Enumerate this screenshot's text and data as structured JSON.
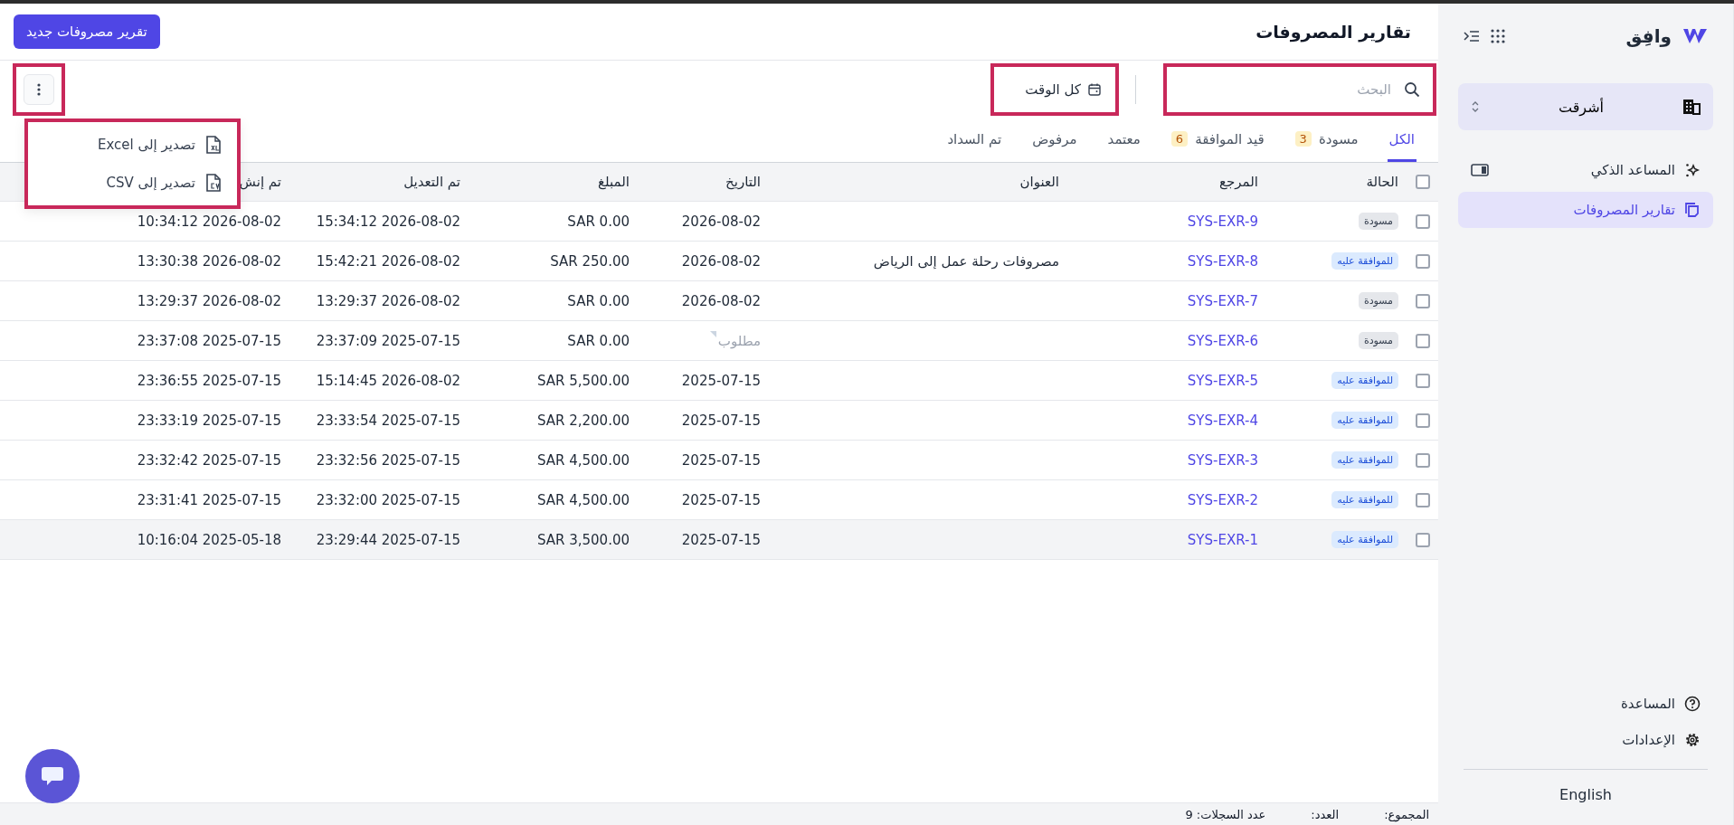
{
  "sidebar": {
    "logo_text": "وافِق",
    "org": "أشرقت",
    "nav": [
      {
        "label": "المساعد الذكي",
        "kind": "assistant",
        "selected": false
      },
      {
        "label": "تقارير المصروفات",
        "kind": "reports",
        "selected": true
      }
    ],
    "footer_links": [
      {
        "label": "المساعدة",
        "kind": "help"
      },
      {
        "label": "الإعدادات",
        "kind": "settings"
      }
    ],
    "language": "English"
  },
  "page": {
    "title": "تقارير المصروفات",
    "new_button": "تقرير مصروفات جديد"
  },
  "search": {
    "placeholder": "البحث",
    "highlighted": true
  },
  "date_filter": {
    "label": "كل الوقت",
    "highlighted": true
  },
  "more_button": {
    "highlighted": true
  },
  "more_menu": {
    "highlighted": true,
    "items": [
      {
        "label": "تصدير إلى Excel",
        "kind": "xls"
      },
      {
        "label": "تصدير إلى CSV",
        "kind": "csv"
      }
    ]
  },
  "tabs": [
    {
      "label": "الكل",
      "selected": true
    },
    {
      "label": "مسودة",
      "count": "3",
      "selected": false
    },
    {
      "label": "قيد الموافقة",
      "count": "6",
      "selected": false
    },
    {
      "label": "معتمد",
      "selected": false
    },
    {
      "label": "مرفوض",
      "selected": false
    },
    {
      "label": "تم السداد",
      "selected": false
    }
  ],
  "table": {
    "all_checked": false,
    "columns": [
      "الحالة",
      "المرجع",
      "العنوان",
      "التاريخ",
      "المبلغ",
      "تم التعديل",
      "تم إنش"
    ],
    "rows": [
      {
        "checked": false,
        "highlighted": false,
        "status": "مسودة",
        "kind": "draft",
        "reference": "SYS-EXR-9",
        "date": "2026-08-02",
        "amount": "SAR 0.00",
        "modified": "15:34:12 2026-08-02",
        "created": "10:34:12 2026-08-02"
      },
      {
        "checked": false,
        "highlighted": false,
        "status": "للموافقة عليه",
        "kind": "pending",
        "reference": "SYS-EXR-8",
        "title": "مصروفات رحلة عمل إلى الرياض",
        "date": "2026-08-02",
        "amount": "SAR 250.00",
        "modified": "15:42:21 2026-08-02",
        "created": "13:30:38 2026-08-02"
      },
      {
        "checked": false,
        "highlighted": false,
        "status": "مسودة",
        "kind": "draft",
        "reference": "SYS-EXR-7",
        "date": "2026-08-02",
        "amount": "SAR 0.00",
        "modified": "13:29:37 2026-08-02",
        "created": "13:29:37 2026-08-02"
      },
      {
        "checked": false,
        "highlighted": false,
        "status": "مسودة",
        "kind": "draft",
        "reference": "SYS-EXR-6",
        "date_placeholder": "مطلوب",
        "amount": "SAR 0.00",
        "modified": "23:37:09 2025-07-15",
        "created": "23:37:08 2025-07-15"
      },
      {
        "checked": false,
        "highlighted": false,
        "status": "للموافقة عليه",
        "kind": "pending",
        "reference": "SYS-EXR-5",
        "date": "2025-07-15",
        "amount": "SAR 5,500.00",
        "modified": "15:14:45 2026-08-02",
        "created": "23:36:55 2025-07-15"
      },
      {
        "checked": false,
        "highlighted": false,
        "status": "للموافقة عليه",
        "kind": "pending",
        "reference": "SYS-EXR-4",
        "date": "2025-07-15",
        "amount": "SAR 2,200.00",
        "modified": "23:33:54 2025-07-15",
        "created": "23:33:19 2025-07-15"
      },
      {
        "checked": false,
        "highlighted": false,
        "status": "للموافقة عليه",
        "kind": "pending",
        "reference": "SYS-EXR-3",
        "date": "2025-07-15",
        "amount": "SAR 4,500.00",
        "modified": "23:32:56 2025-07-15",
        "created": "23:32:42 2025-07-15"
      },
      {
        "checked": false,
        "highlighted": false,
        "status": "للموافقة عليه",
        "kind": "pending",
        "reference": "SYS-EXR-2",
        "date": "2025-07-15",
        "amount": "SAR 4,500.00",
        "modified": "23:32:00 2025-07-15",
        "created": "23:31:41 2025-07-15"
      },
      {
        "checked": false,
        "highlighted": true,
        "status": "للموافقة عليه",
        "kind": "pending",
        "reference": "SYS-EXR-1",
        "date": "2025-07-15",
        "amount": "SAR 3,500.00",
        "modified": "23:29:44 2025-07-15",
        "created": "10:16:04 2025-05-18"
      }
    ]
  },
  "footer": {
    "total_label": "المجموع:",
    "count_label": "العدد:",
    "records": "عدد السجلات: 9"
  }
}
